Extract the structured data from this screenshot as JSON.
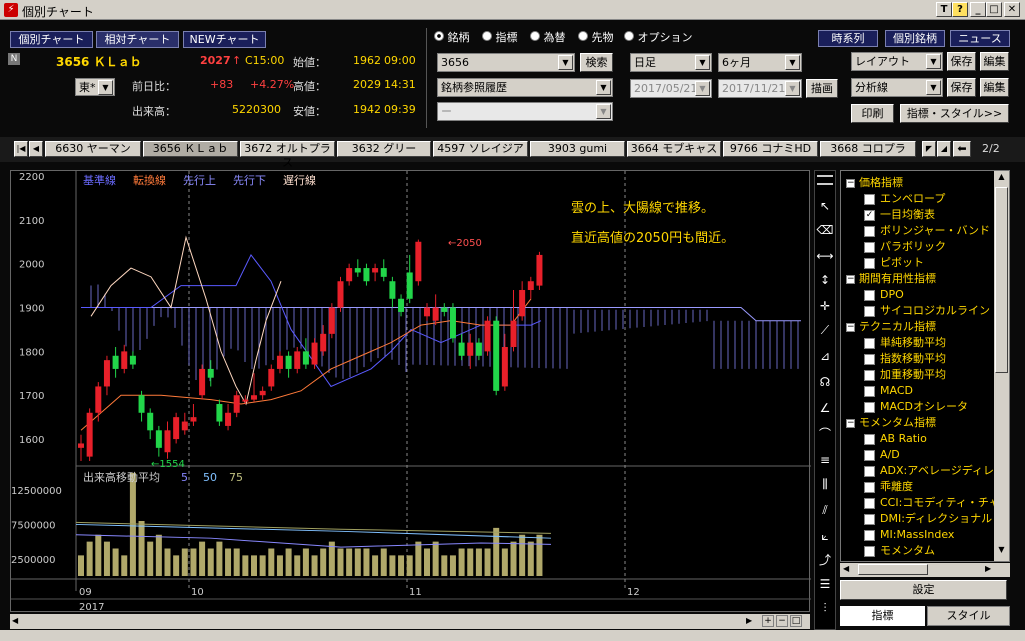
{
  "window": {
    "title": "個別チャート"
  },
  "nav": {
    "kobetsu": "個別チャート",
    "soutai": "相対チャート",
    "newchart": "NEWチャート",
    "jikeiretsu": "時系列",
    "kobetsumeigara": "個別銘柄",
    "news": "ニュース"
  },
  "quote": {
    "market_flag": "N",
    "code_name": "3656 ＫＬａｂ",
    "exchange": "東*",
    "price": "2027",
    "arrow": "↑",
    "close_time": "C15:00",
    "change_label": "前日比：",
    "change": "+83",
    "change_pct": "+4.27%",
    "volume_label": "出来高：",
    "volume": "5220300",
    "open_label": "始値：",
    "open": "1962",
    "open_time": "09:00",
    "high_label": "高値：",
    "high": "2029",
    "high_time": "14:31",
    "low_label": "安値：",
    "low": "1942",
    "low_time": "09:39"
  },
  "radios": [
    {
      "label": "銘柄",
      "checked": true
    },
    {
      "label": "指標",
      "checked": false
    },
    {
      "label": "為替",
      "checked": false
    },
    {
      "label": "先物",
      "checked": false
    },
    {
      "label": "オプション",
      "checked": false
    }
  ],
  "search": {
    "code": "3656",
    "button": "検索",
    "history": "銘柄参照履歴",
    "blank": "ー"
  },
  "period": {
    "type": "日足",
    "range": "6ヶ月",
    "from": "2017/05/21",
    "to": "2017/11/21",
    "draw": "描画"
  },
  "right_controls": {
    "layout": "レイアウト",
    "save": "保存",
    "edit": "編集",
    "analysis": "分析線",
    "print": "印刷",
    "indicator_style": "指標・スタイル>>"
  },
  "tabs": [
    "6630 ヤーマン",
    "3656 ＫＬａｂ",
    "3672 オルトプラス",
    "3632 グリー",
    "4597 ソレイジア",
    "3903 gumi",
    "3664 モブキャス",
    "9766 コナミHD",
    "3668 コロプラ"
  ],
  "page_indicator": "2/2",
  "legend": [
    {
      "label": "基準線",
      "color": "#6b6bff"
    },
    {
      "label": "転換線",
      "color": "#ff7a3a"
    },
    {
      "label": "先行上",
      "color": "#8c8cff"
    },
    {
      "label": "先行下",
      "color": "#8c8cff"
    },
    {
      "label": "遅行線",
      "color": "#ffe0d0"
    }
  ],
  "annotation": {
    "line1": "雲の上、大陽線で推移。",
    "line2": "直近高値の2050円も間近。"
  },
  "price_labels": {
    "high": "2050",
    "low": "1554"
  },
  "volume_legend": {
    "title": "出来高移動平均",
    "p1": "5",
    "p2": "50",
    "p3": "75"
  },
  "x_labels": {
    "m09": "09",
    "m10": "10",
    "m11": "11",
    "m12": "12",
    "year": "2017"
  },
  "chart_data": {
    "type": "candlestick",
    "yticks": [
      1600,
      1700,
      1800,
      1900,
      2000,
      2100,
      2200
    ],
    "ylim": [
      1550,
      2200
    ],
    "vol_ticks": [
      "12500000",
      "7500000",
      "2500000"
    ],
    "vol_ylim": [
      0,
      16000000
    ],
    "candles": [
      [
        1580,
        1590,
        1550,
        1610
      ],
      [
        1560,
        1660,
        1550,
        1670
      ],
      [
        1660,
        1720,
        1640,
        1730
      ],
      [
        1720,
        1780,
        1700,
        1790
      ],
      [
        1790,
        1760,
        1740,
        1810
      ],
      [
        1760,
        1800,
        1750,
        1815
      ],
      [
        1790,
        1770,
        1760,
        1800
      ],
      [
        1700,
        1660,
        1640,
        1710
      ],
      [
        1660,
        1620,
        1600,
        1670
      ],
      [
        1620,
        1580,
        1560,
        1630
      ],
      [
        1570,
        1620,
        1555,
        1640
      ],
      [
        1600,
        1650,
        1590,
        1660
      ],
      [
        1620,
        1640,
        1610,
        1660
      ],
      [
        1640,
        1650,
        1630,
        1680
      ],
      [
        1700,
        1760,
        1690,
        1770
      ],
      [
        1760,
        1740,
        1720,
        1780
      ],
      [
        1680,
        1640,
        1630,
        1690
      ],
      [
        1630,
        1660,
        1620,
        1680
      ],
      [
        1660,
        1700,
        1650,
        1710
      ],
      [
        1690,
        1690,
        1680,
        1700
      ],
      [
        1690,
        1700,
        1685,
        1750
      ],
      [
        1700,
        1710,
        1690,
        1720
      ],
      [
        1720,
        1760,
        1710,
        1770
      ],
      [
        1760,
        1790,
        1750,
        1800
      ],
      [
        1790,
        1760,
        1740,
        1800
      ],
      [
        1760,
        1800,
        1750,
        1810
      ],
      [
        1800,
        1770,
        1760,
        1830
      ],
      [
        1770,
        1820,
        1760,
        1830
      ],
      [
        1800,
        1840,
        1790,
        1860
      ],
      [
        1840,
        1900,
        1830,
        1910
      ],
      [
        1900,
        1960,
        1890,
        1970
      ],
      [
        1960,
        1990,
        1950,
        2000
      ],
      [
        1990,
        1980,
        1970,
        2010
      ],
      [
        1990,
        1960,
        1950,
        2000
      ],
      [
        1980,
        1990,
        1960,
        2000
      ],
      [
        1990,
        1970,
        1960,
        2010
      ],
      [
        1960,
        1920,
        1900,
        1970
      ],
      [
        1920,
        1890,
        1880,
        1930
      ],
      [
        1980,
        1920,
        1910,
        2020
      ],
      [
        1960,
        2050,
        1950,
        2055
      ],
      [
        1880,
        1900,
        1870,
        1910
      ],
      [
        1870,
        1900,
        1860,
        1930
      ],
      [
        1900,
        1890,
        1880,
        1910
      ],
      [
        1900,
        1830,
        1820,
        1910
      ],
      [
        1820,
        1790,
        1780,
        1840
      ],
      [
        1790,
        1820,
        1760,
        1840
      ],
      [
        1820,
        1790,
        1780,
        1830
      ],
      [
        1800,
        1870,
        1790,
        1880
      ],
      [
        1870,
        1710,
        1700,
        1880
      ],
      [
        1720,
        1810,
        1710,
        1840
      ],
      [
        1810,
        1870,
        1800,
        1940
      ],
      [
        1880,
        1940,
        1870,
        1960
      ],
      [
        1940,
        1960,
        1920,
        1970
      ],
      [
        1950,
        2020,
        1940,
        2027
      ]
    ],
    "volume": [
      3,
      5,
      6,
      5,
      4,
      3,
      15,
      8,
      5,
      6,
      4,
      3,
      4,
      4,
      5,
      4,
      5,
      4,
      4,
      3,
      3,
      3,
      4,
      3,
      4,
      3,
      4,
      3,
      4,
      5,
      4,
      4,
      4,
      4,
      3,
      4,
      3,
      3,
      3,
      5,
      4,
      5,
      3,
      3,
      4,
      4,
      4,
      4,
      7,
      4,
      5,
      6,
      5,
      6
    ]
  },
  "side": {
    "tree": [
      {
        "type": "group",
        "label": "価格指標"
      },
      {
        "type": "item",
        "label": "エンベロープ",
        "checked": false
      },
      {
        "type": "item",
        "label": "一目均衡表",
        "checked": true
      },
      {
        "type": "item",
        "label": "ボリンジャー・バンド",
        "checked": false
      },
      {
        "type": "item",
        "label": "パラボリック",
        "checked": false
      },
      {
        "type": "item",
        "label": "ピボット",
        "checked": false
      },
      {
        "type": "group",
        "label": "期間有用性指標"
      },
      {
        "type": "item",
        "label": "DPO",
        "checked": false
      },
      {
        "type": "item",
        "label": "サイコロジカルライン",
        "checked": false
      },
      {
        "type": "group",
        "label": "テクニカル指標"
      },
      {
        "type": "item",
        "label": "単純移動平均",
        "checked": false
      },
      {
        "type": "item",
        "label": "指数移動平均",
        "checked": false
      },
      {
        "type": "item",
        "label": "加重移動平均",
        "checked": false
      },
      {
        "type": "item",
        "label": "MACD",
        "checked": false
      },
      {
        "type": "item",
        "label": "MACDオシレータ",
        "checked": false
      },
      {
        "type": "group",
        "label": "モメンタム指標"
      },
      {
        "type": "item",
        "label": "AB Ratio",
        "checked": false
      },
      {
        "type": "item",
        "label": "A/D",
        "checked": false
      },
      {
        "type": "item",
        "label": "ADX:アベレージディレ",
        "checked": false
      },
      {
        "type": "item",
        "label": "乖離度",
        "checked": false
      },
      {
        "type": "item",
        "label": "CCI:コモディティ・チャ",
        "checked": false
      },
      {
        "type": "item",
        "label": "DMI:ディレクショナル",
        "checked": false
      },
      {
        "type": "item",
        "label": "MI:MassIndex",
        "checked": false
      },
      {
        "type": "item",
        "label": "モメンタム",
        "checked": false
      }
    ],
    "settings": "設定",
    "tab_indicator": "指標",
    "tab_style": "スタイル"
  },
  "colors": {
    "up": "#e8202a",
    "down": "#22d64a",
    "volume": "#b0a86a",
    "cloud": "#8c8cff"
  }
}
